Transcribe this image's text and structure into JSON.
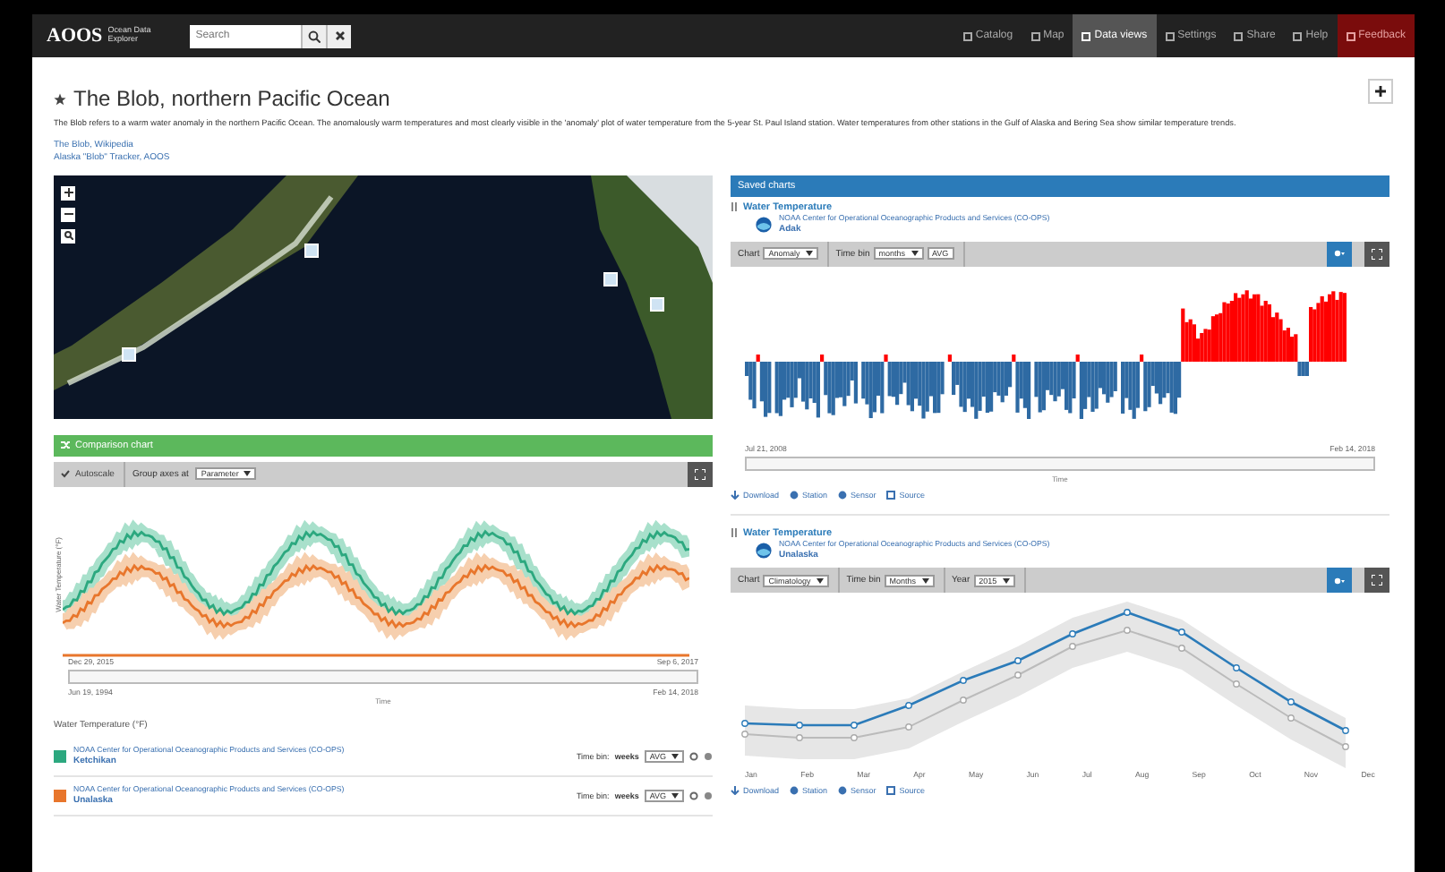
{
  "navbar": {
    "logo": "AOOS",
    "logo_sub": "Ocean Data Explorer",
    "search_placeholder": "Search",
    "items": [
      {
        "label": "Catalog",
        "kind": "plain",
        "selected": false
      },
      {
        "label": "Map",
        "kind": "plain",
        "selected": false
      },
      {
        "label": "Data views",
        "kind": "plain",
        "selected": true
      },
      {
        "label": "Settings",
        "kind": "plain",
        "selected": false
      },
      {
        "label": "Share",
        "kind": "plain",
        "selected": false
      },
      {
        "label": "Help",
        "kind": "plain",
        "selected": false
      },
      {
        "label": "Feedback",
        "kind": "alert",
        "selected": false
      }
    ]
  },
  "page": {
    "title": "The Blob, northern Pacific Ocean",
    "description": "The Blob refers to a warm water anomaly in the northern Pacific Ocean. The anomalously warm temperatures and most clearly visible in the 'anomaly' plot of water temperature from the 5-year St. Paul Island station. Water temperatures from other stations in the Gulf of Alaska and Bering Sea show similar temperature trends.",
    "links": [
      "The Blob, Wikipedia",
      "Alaska \"Blob\" Tracker, AOOS"
    ]
  },
  "comparison": {
    "title": "Comparison chart",
    "autoscale": "Autoscale",
    "group_label": "Group axes at",
    "group_value": "Parameter",
    "ylabel": "Water Temperature (°F)",
    "x_start": "Dec 29, 2015",
    "x_end": "Sep 6, 2017",
    "nav_start": "Jun 19, 1994",
    "nav_end": "Feb 14, 2018",
    "xlabel": "Time",
    "legend_title": "Water Temperature (°F)",
    "series": [
      {
        "provider": "NOAA Center for Operational Oceanographic Products and Services (CO-OPS)",
        "station": "Ketchikan",
        "color": "#2ca87f",
        "time_bin_label": "Time bin:",
        "time_bin": "weeks",
        "agg": "AVG"
      },
      {
        "provider": "NOAA Center for Operational Oceanographic Products and Services (CO-OPS)",
        "station": "Unalaska",
        "color": "#e8762c",
        "time_bin_label": "Time bin:",
        "time_bin": "weeks",
        "agg": "AVG"
      }
    ]
  },
  "saved": {
    "title": "Saved charts",
    "charts": [
      {
        "kind": "anomaly",
        "title": "Water Temperature",
        "provider": "NOAA Center for Operational Oceanographic Products and Services (CO-OPS)",
        "station": "Adak",
        "chart_label": "Chart",
        "chart_value": "Anomaly",
        "time_bin_label": "Time bin",
        "time_bin": "months",
        "agg": "AVG",
        "x_start": "Jul 21, 2008",
        "x_end": "Feb 14, 2018",
        "xlabel": "Time",
        "links": [
          "Download",
          "Station",
          "Sensor",
          "Source"
        ]
      },
      {
        "kind": "climatology",
        "title": "Water Temperature",
        "provider": "NOAA Center for Operational Oceanographic Products and Services (CO-OPS)",
        "station": "Unalaska",
        "chart_label": "Chart",
        "chart_value": "Climatology",
        "time_bin_label": "Time bin",
        "time_bin": "Months",
        "year_label": "Year",
        "year": "2015",
        "months": [
          "Jan",
          "Feb",
          "Mar",
          "Apr",
          "May",
          "Jun",
          "Jul",
          "Aug",
          "Sep",
          "Oct",
          "Nov",
          "Dec"
        ],
        "links": [
          "Download",
          "Station",
          "Sensor",
          "Source"
        ]
      }
    ]
  }
}
